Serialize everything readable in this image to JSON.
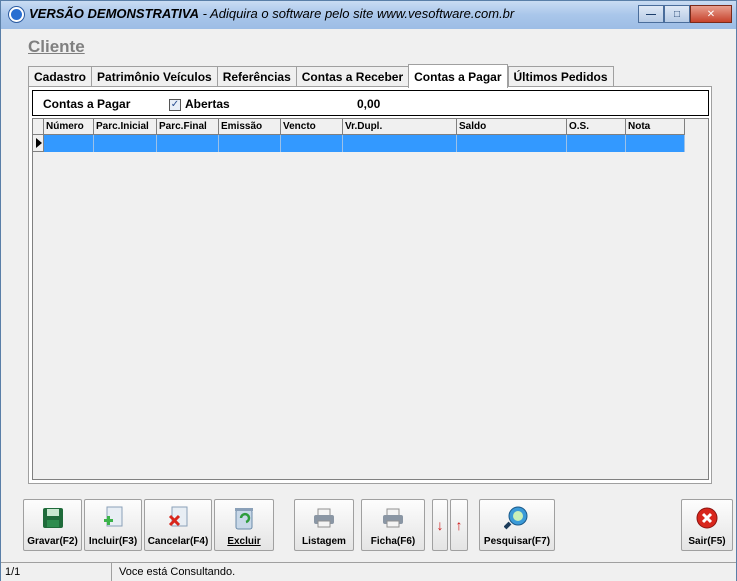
{
  "window": {
    "title_prefix": "VERSÃO DEMONSTRATIVA",
    "title_suffix": " - Adiquira o software pelo site www.vesoftware.com.br"
  },
  "form": {
    "header": "Cliente"
  },
  "tabs": [
    {
      "label": "Cadastro"
    },
    {
      "label": "Patrimônio Veículos"
    },
    {
      "label": "Referências"
    },
    {
      "label": "Contas a Receber"
    },
    {
      "label": "Contas a Pagar"
    },
    {
      "label": "Últimos Pedidos"
    }
  ],
  "active_tab": "Contas a Pagar",
  "filter": {
    "label": "Contas a Pagar",
    "checkbox_label": "Abertas",
    "checkbox_checked": true,
    "total": "0,00"
  },
  "grid": {
    "columns": [
      "Número",
      "Parc.Inicial",
      "Parc.Final",
      "Emissão",
      "Vencto",
      "Vr.Dupl.",
      "Saldo",
      "O.S.",
      "Nota"
    ],
    "rows": [
      [
        "",
        "",
        "",
        "",
        "",
        "",
        "",
        "",
        ""
      ]
    ]
  },
  "toolbar": {
    "save": "Gravar(F2)",
    "add": "Incluir(F3)",
    "cancel": "Cancelar(F4)",
    "delete": "Excluir",
    "list": "Listagem",
    "sheet": "Ficha(F6)",
    "search": "Pesquisar(F7)",
    "exit": "Sair(F5)"
  },
  "status": {
    "page": "1/1",
    "message": "Voce está Consultando."
  },
  "colors": {
    "selection": "#3399ff",
    "window_bg": "#f0f0f0"
  }
}
